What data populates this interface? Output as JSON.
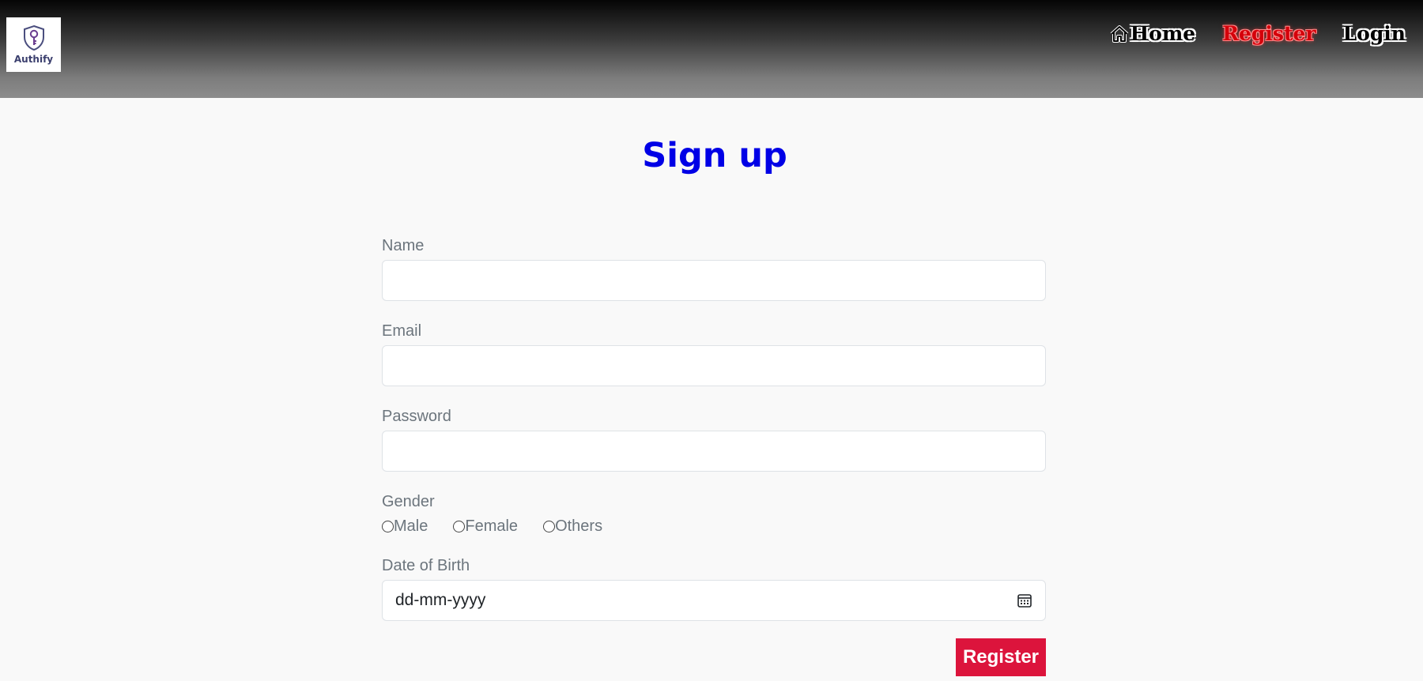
{
  "brand": {
    "logo_text": "Authify"
  },
  "nav": {
    "home": "Home",
    "register": "Register",
    "login": "Login"
  },
  "page": {
    "title": "Sign up"
  },
  "form": {
    "name_label": "Name",
    "name_value": "",
    "email_label": "Email",
    "email_value": "",
    "password_label": "Password",
    "password_value": "",
    "gender_label": "Gender",
    "gender_options": [
      "Male",
      "Female",
      "Others"
    ],
    "dob_label": "Date of Birth",
    "dob_placeholder": "dd-mm-yyyy",
    "submit_label": "Register"
  },
  "colors": {
    "title": "#0000e6",
    "button": "#dc143c",
    "nav_active": "#d4000a"
  },
  "icons": {
    "logo": "key-shield-icon",
    "home": "home-icon",
    "calendar": "calendar-icon"
  }
}
